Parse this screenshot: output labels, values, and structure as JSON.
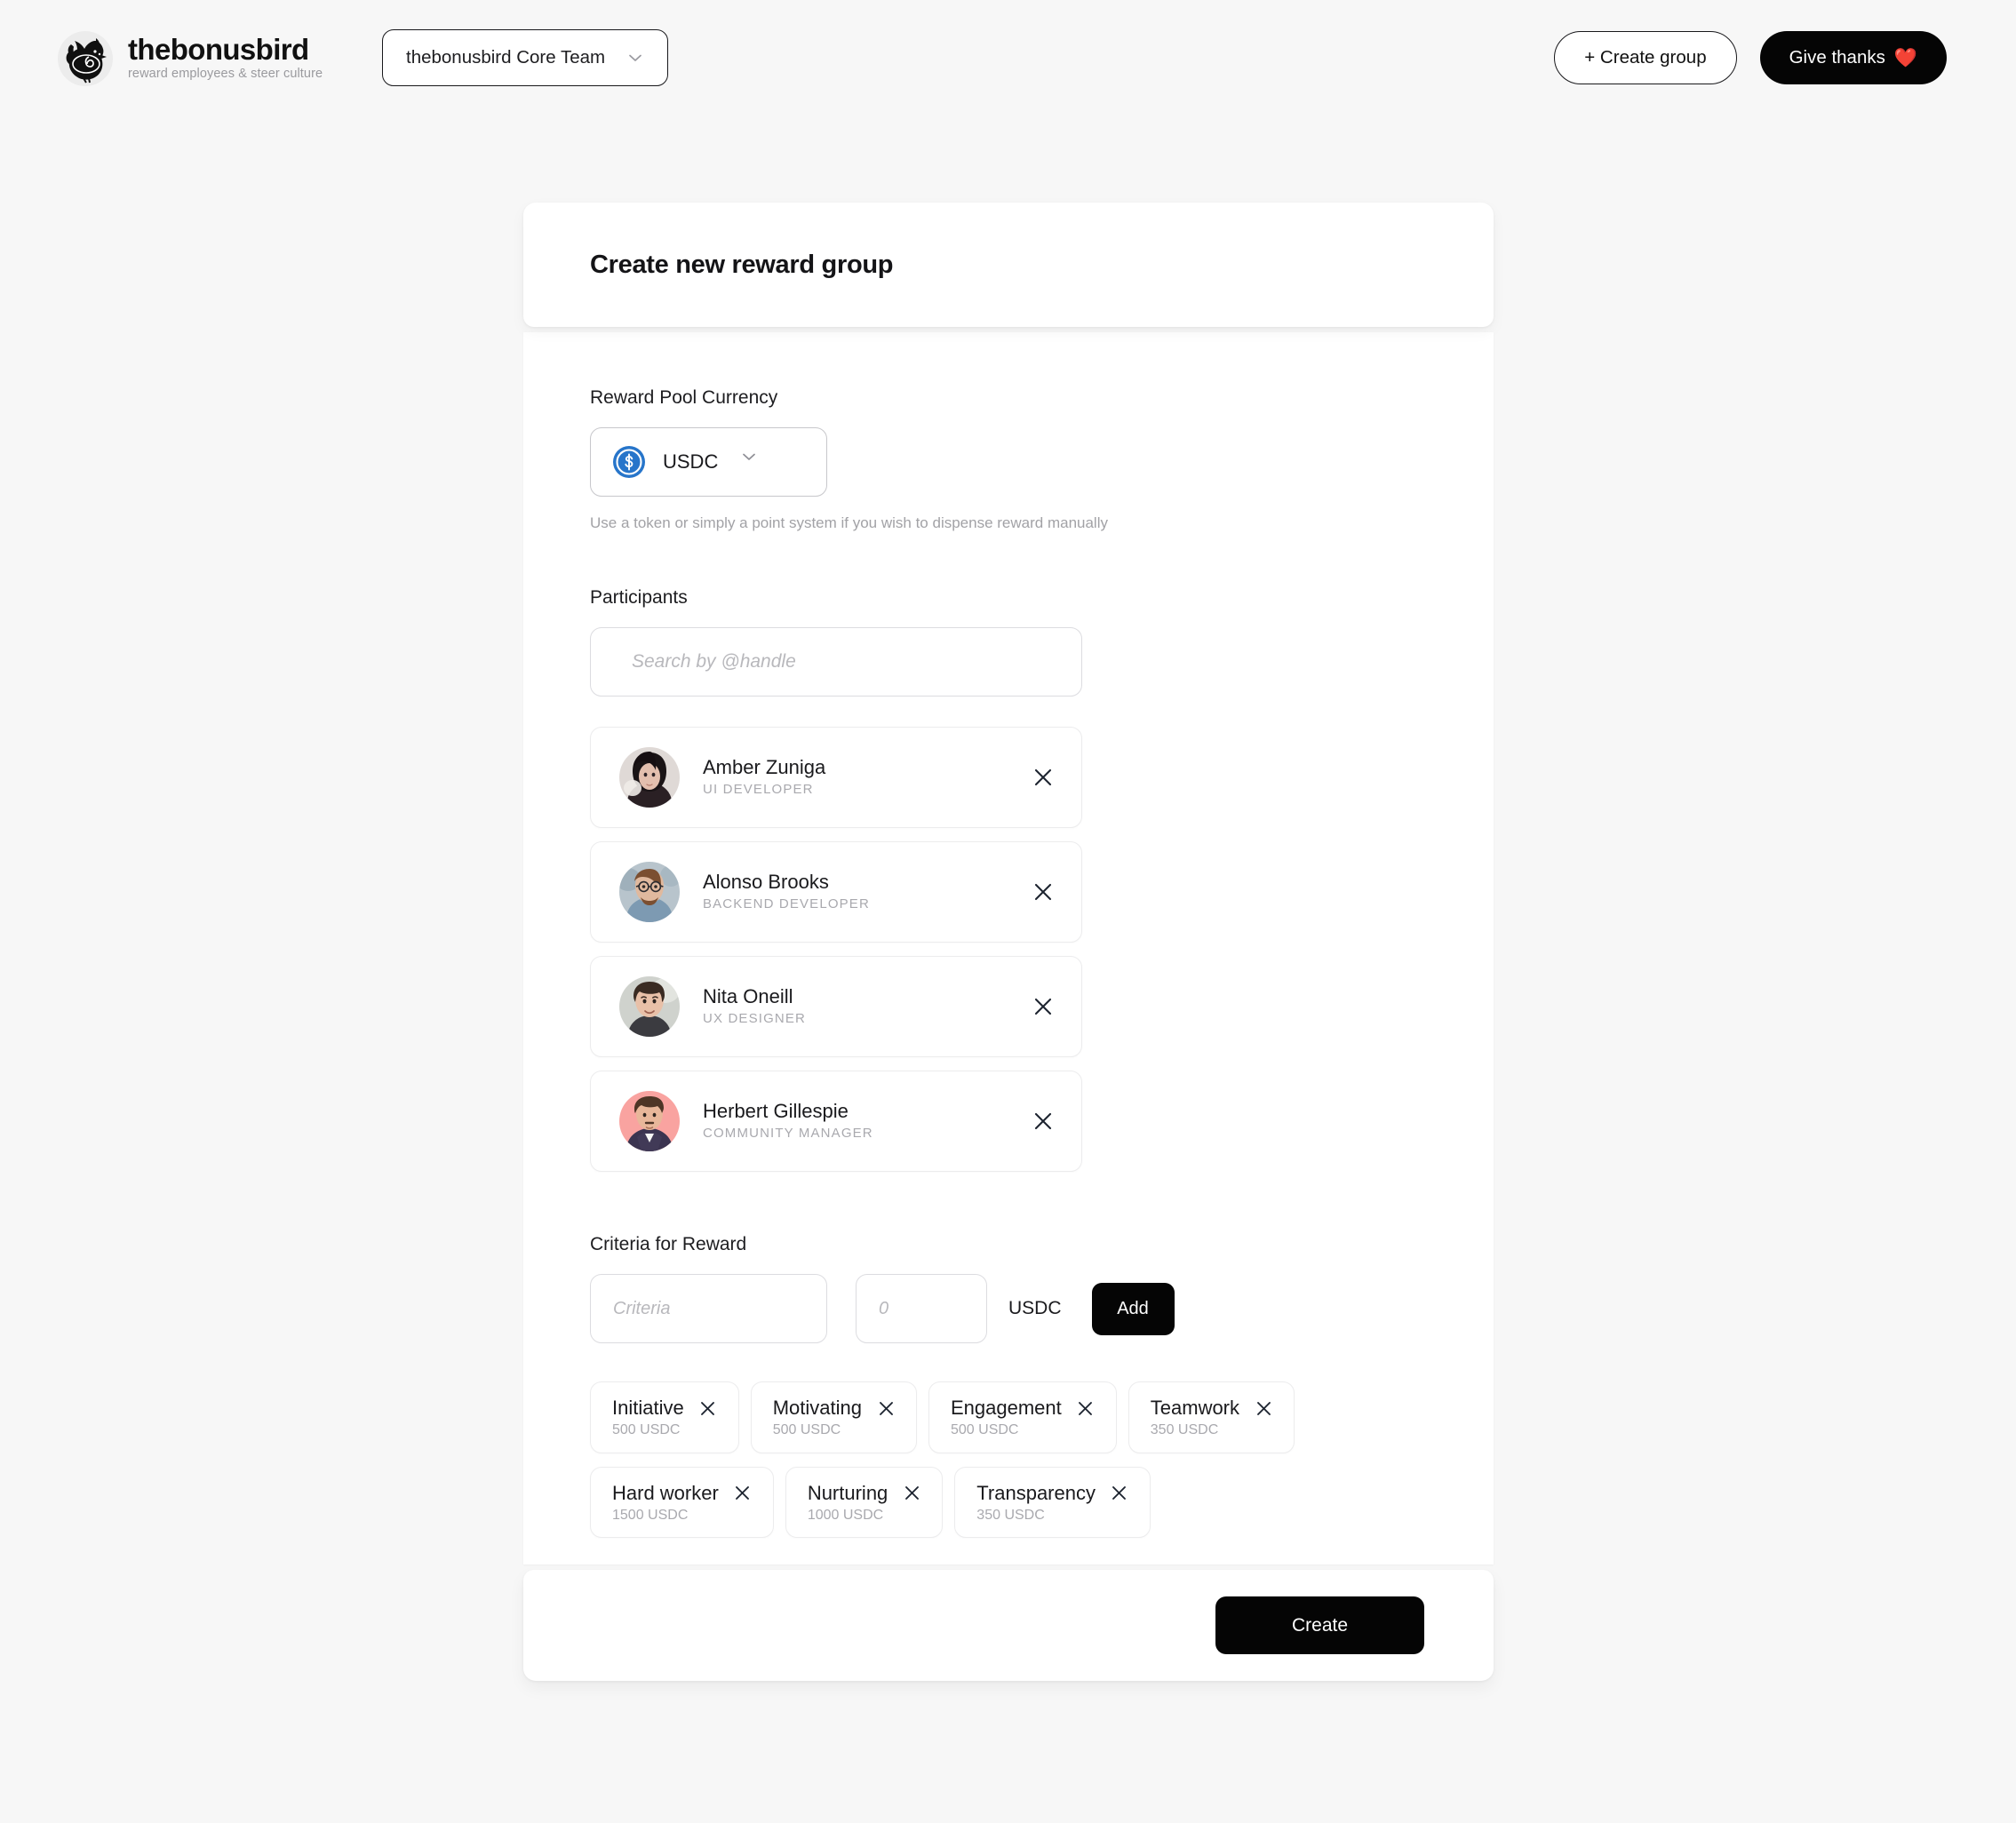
{
  "brand": {
    "name": "thebonusbird",
    "tagline": "reward employees & steer culture",
    "logo_icon": "bird-logo-icon"
  },
  "topbar": {
    "team_selector": {
      "value": "thebonusbird Core Team",
      "chevron_icon": "chevron-down-icon"
    },
    "create_group_label": "+ Create group",
    "give_thanks_label": "Give thanks",
    "give_thanks_emoji": "❤️"
  },
  "card": {
    "title": "Create new reward group",
    "currency": {
      "label": "Reward Pool Currency",
      "selected": "USDC",
      "token_icon": "usdc-coin-icon",
      "chevron_icon": "chevron-down-icon",
      "hint": "Use a token or simply a point system if you wish to dispense reward manually"
    },
    "participants": {
      "label": "Participants",
      "search_placeholder": "Search by @handle",
      "search_value": "",
      "remove_icon": "close-x-icon",
      "items": [
        {
          "name": "Amber Zuniga",
          "role": "UI DEVELOPER"
        },
        {
          "name": "Alonso Brooks",
          "role": "BACKEND DEVELOPER"
        },
        {
          "name": "Nita Oneill",
          "role": "UX DESIGNER"
        },
        {
          "name": "Herbert Gillespie",
          "role": "COMMUNITY MANAGER"
        }
      ]
    },
    "criteria": {
      "label": "Criteria for Reward",
      "name_placeholder": "Criteria",
      "name_value": "",
      "amount_placeholder": "0",
      "amount_value": "",
      "unit": "USDC",
      "add_label": "Add",
      "remove_icon": "close-x-icon",
      "chips": [
        {
          "label": "Initiative",
          "amount": "500 USDC"
        },
        {
          "label": "Motivating",
          "amount": "500 USDC"
        },
        {
          "label": "Engagement",
          "amount": "500 USDC"
        },
        {
          "label": "Teamwork",
          "amount": "350 USDC"
        },
        {
          "label": "Hard worker",
          "amount": "1500 USDC"
        },
        {
          "label": "Nurturing",
          "amount": "1000 USDC"
        },
        {
          "label": "Transparency",
          "amount": "350 USDC"
        }
      ]
    },
    "footer": {
      "create_label": "Create"
    }
  },
  "colors": {
    "page_bg": "#f7f7f7",
    "card_bg": "#ffffff",
    "accent_dark": "#050505",
    "usdc_blue": "#2775ca",
    "muted_text": "#a9a9ae",
    "heart_red": "#ea3a3a"
  }
}
